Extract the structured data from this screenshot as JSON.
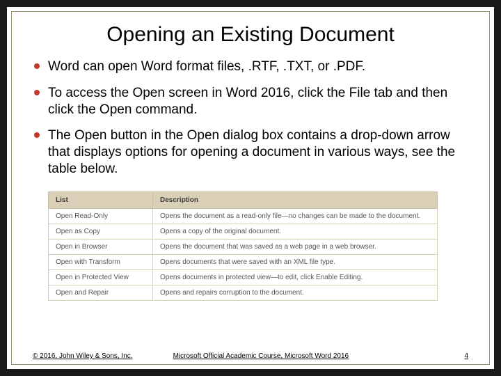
{
  "title": "Opening an Existing Document",
  "bullets": [
    "Word can open Word format files, .RTF, .TXT, or .PDF.",
    "To access the Open screen in Word 2016, click the File tab and then click the Open command.",
    "The Open button in the Open dialog box contains a drop-down arrow that displays options for opening a document in various ways, see the table below."
  ],
  "table": {
    "headers": [
      "List",
      "Description"
    ],
    "rows": [
      [
        "Open Read-Only",
        "Opens the document as a read-only file—no changes can be made to the document."
      ],
      [
        "Open as Copy",
        "Opens a copy of the original document."
      ],
      [
        "Open in Browser",
        "Opens the document that was saved as a web page in a web browser."
      ],
      [
        "Open with Transform",
        "Opens documents that were saved with an XML file type."
      ],
      [
        "Open in Protected View",
        "Opens documents in protected view—to edit, click Enable Editing."
      ],
      [
        "Open and Repair",
        "Opens and repairs corruption to the document."
      ]
    ]
  },
  "footer": {
    "copyright": "© 2016, John Wiley & Sons, Inc.",
    "course": "Microsoft Official Academic Course, Microsoft Word 2016",
    "page": "4"
  }
}
